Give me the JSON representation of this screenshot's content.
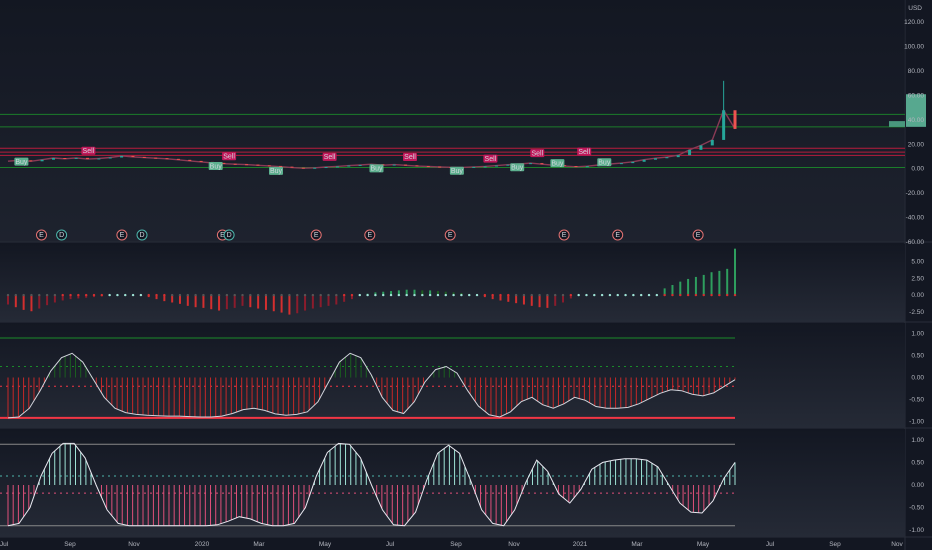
{
  "currency": "USD",
  "colors": {
    "bg": "#131722",
    "up": "#26a69a",
    "down": "#ef5350",
    "bright_red": "#f23645",
    "green_line": "#1b7d2a",
    "panel_border": "#2a2e39",
    "text": "#b2b5be",
    "tag_sell": "#c2185b",
    "tag_buy": "#5cb08e",
    "event_e": "#e57373",
    "event_d": "#4db6ac",
    "osc1_line": "#d1d4dc",
    "osc2_pos": "#9fe3d6",
    "osc2_neg": "#e0507a"
  },
  "x_axis": {
    "labels": [
      "Jul",
      "Sep",
      "Nov",
      "2020",
      "Mar",
      "May",
      "Jul",
      "Sep",
      "Nov",
      "2021",
      "Mar",
      "May",
      "Jul",
      "Sep",
      "Nov"
    ]
  },
  "chart_data": [
    {
      "type": "line",
      "panel": "price",
      "y_axis_ticks": [
        "120.00",
        "100.00",
        "80.00",
        "60.00",
        "40.00",
        "20.00",
        "0.00",
        "-20.00",
        "-40.00",
        "-60.00"
      ],
      "ylim": [
        -60,
        130
      ],
      "series": [
        {
          "values": [
            6.2,
            6.9,
            6.1,
            7.4,
            8.8,
            8.1,
            8.9,
            7.9,
            8.4,
            9.2,
            10.5,
            9.7,
            9.1,
            8.6,
            8.1,
            7.3,
            6.4,
            5.6,
            4.8,
            4.1,
            3.7,
            3.4,
            2.8,
            2.3,
            1.7,
            0.9,
            0.4,
            0.8,
            1.4,
            1.9,
            2.6,
            3.1,
            3.7,
            2.9,
            3.4,
            2.8,
            2.2,
            1.8,
            1.4,
            1.2,
            1.1,
            1.5,
            1.9,
            2.6,
            3.3,
            3.9,
            4.6,
            3.7,
            2.9,
            2.2,
            1.6,
            2.1,
            3.1,
            3.9,
            4.6,
            5.7,
            7.4,
            8.6,
            9.5,
            11.1,
            15.5,
            19.1,
            23.6,
            47.9,
            32.6
          ]
        }
      ],
      "hlines": [
        {
          "value": 44.5,
          "color": "green"
        },
        {
          "value": 34.3,
          "color": "green"
        },
        {
          "value": 16.8,
          "color": "red"
        },
        {
          "value": 13.6,
          "color": "red"
        },
        {
          "value": 10.9,
          "color": "red"
        },
        {
          "value": 1.0,
          "color": "green"
        }
      ],
      "spike_high": 72.0,
      "right_box": {
        "from": 45.0,
        "to": 34.3
      },
      "markers": [
        {
          "label": "Sell",
          "index": 12,
          "value": 14.7,
          "kind": "sell"
        },
        {
          "label": "Buy",
          "index": 2,
          "value": 5.8,
          "kind": "buy"
        },
        {
          "label": "Sell",
          "index": 33,
          "value": 10.2,
          "kind": "sell"
        },
        {
          "label": "Buy",
          "index": 31,
          "value": 2.2,
          "kind": "buy"
        },
        {
          "label": "Sell",
          "index": 48,
          "value": 9.7,
          "kind": "sell"
        },
        {
          "label": "Buy",
          "index": 40,
          "value": -1.8,
          "kind": "buy"
        },
        {
          "label": "Sell",
          "index": 60,
          "value": 9.6,
          "kind": "sell"
        },
        {
          "label": "Buy",
          "index": 55,
          "value": 0.3,
          "kind": "buy"
        },
        {
          "label": "Sell",
          "index": 72,
          "value": 8.3,
          "kind": "sell"
        },
        {
          "label": "Buy",
          "index": 67,
          "value": -1.6,
          "kind": "buy"
        },
        {
          "label": "Sell",
          "index": 79,
          "value": 12.8,
          "kind": "sell"
        },
        {
          "label": "Buy",
          "index": 76,
          "value": 1.2,
          "kind": "buy"
        },
        {
          "label": "Sell",
          "index": 86,
          "value": 14.0,
          "kind": "sell"
        },
        {
          "label": "Buy",
          "index": 82,
          "value": 4.6,
          "kind": "buy"
        },
        {
          "label": "Buy",
          "index": 89,
          "value": 5.3,
          "kind": "buy"
        }
      ],
      "events": [
        {
          "label": "E",
          "index": 5,
          "kind": "earnings"
        },
        {
          "label": "D",
          "index": 8,
          "kind": "dividend"
        },
        {
          "label": "E",
          "index": 17,
          "kind": "earnings"
        },
        {
          "label": "D",
          "index": 20,
          "kind": "dividend"
        },
        {
          "label": "E",
          "index": 32,
          "kind": "earnings"
        },
        {
          "label": "D",
          "index": 33,
          "kind": "dividend"
        },
        {
          "label": "E",
          "index": 46,
          "kind": "earnings"
        },
        {
          "label": "E",
          "index": 54,
          "kind": "earnings"
        },
        {
          "label": "E",
          "index": 66,
          "kind": "earnings"
        },
        {
          "label": "E",
          "index": 83,
          "kind": "earnings"
        },
        {
          "label": "E",
          "index": 91,
          "kind": "earnings"
        },
        {
          "label": "E",
          "index": 103,
          "kind": "earnings"
        }
      ]
    },
    {
      "type": "bar",
      "panel": "squeeze_momentum",
      "y_axis_ticks": [
        "5.00",
        "2.50",
        "0.00",
        "-2.50"
      ],
      "ylim": [
        -4,
        7
      ],
      "values": [
        -1.4,
        -1.8,
        -2.2,
        -2.4,
        -2.0,
        -1.5,
        -1.1,
        -0.8,
        -0.6,
        -0.5,
        -0.4,
        -0.3,
        -0.2,
        0,
        0,
        0,
        0,
        0,
        -0.3,
        -0.6,
        -0.9,
        -1.1,
        -1.3,
        -1.6,
        -1.8,
        -1.9,
        -2.1,
        -2.3,
        -2.1,
        -1.9,
        -1.6,
        -1.8,
        -2.0,
        -2.2,
        -2.4,
        -2.6,
        -2.9,
        -2.7,
        -2.3,
        -2.0,
        -1.8,
        -1.6,
        -1.4,
        -1.0,
        -0.6,
        0,
        0.2,
        0.4,
        0.5,
        0.6,
        0.7,
        0.8,
        0.8,
        0.7,
        0.7,
        0.6,
        0.5,
        0.4,
        0.3,
        0.1,
        0,
        -0.3,
        -0.6,
        -0.8,
        -1.0,
        -1.2,
        -1.4,
        -1.6,
        -1.8,
        -1.9,
        -1.6,
        -1.1,
        -0.5,
        0,
        0,
        0,
        0,
        0,
        0,
        0,
        0,
        0,
        0,
        0,
        1.0,
        1.5,
        2.0,
        2.4,
        2.7,
        3.0,
        3.4,
        3.6,
        3.9,
        6.9
      ]
    },
    {
      "type": "area",
      "panel": "oscillator_1",
      "y_axis_ticks": [
        "1.00",
        "0.50",
        "0.00",
        "-0.50",
        "-1.00"
      ],
      "ylim": [
        -1.15,
        1.15
      ],
      "levels": [
        0.9,
        0.25,
        -0.2,
        -0.92
      ],
      "values": [
        -0.92,
        -0.9,
        -0.7,
        -0.3,
        0.15,
        0.45,
        0.55,
        0.35,
        -0.05,
        -0.45,
        -0.7,
        -0.8,
        -0.84,
        -0.86,
        -0.87,
        -0.88,
        -0.88,
        -0.89,
        -0.9,
        -0.9,
        -0.88,
        -0.82,
        -0.73,
        -0.7,
        -0.75,
        -0.83,
        -0.86,
        -0.84,
        -0.78,
        -0.55,
        -0.1,
        0.35,
        0.55,
        0.45,
        0.05,
        -0.45,
        -0.75,
        -0.82,
        -0.55,
        -0.1,
        0.18,
        0.25,
        0.1,
        -0.3,
        -0.65,
        -0.85,
        -0.9,
        -0.78,
        -0.55,
        -0.45,
        -0.62,
        -0.7,
        -0.6,
        -0.45,
        -0.52,
        -0.66,
        -0.7,
        -0.7,
        -0.68,
        -0.6,
        -0.48,
        -0.36,
        -0.28,
        -0.3,
        -0.38,
        -0.42,
        -0.35,
        -0.2,
        -0.05
      ]
    },
    {
      "type": "area",
      "panel": "oscillator_2",
      "y_axis_ticks": [
        "1.00",
        "0.50",
        "0.00",
        "-0.50",
        "-1.00"
      ],
      "ylim": [
        -1.15,
        1.15
      ],
      "levels": [
        0.9,
        0.2,
        -0.18,
        -0.9
      ],
      "values": [
        -0.9,
        -0.85,
        -0.5,
        0.2,
        0.7,
        0.92,
        0.92,
        0.6,
        0.0,
        -0.55,
        -0.85,
        -0.9,
        -0.9,
        -0.9,
        -0.9,
        -0.9,
        -0.9,
        -0.9,
        -0.9,
        -0.88,
        -0.8,
        -0.7,
        -0.75,
        -0.85,
        -0.9,
        -0.9,
        -0.85,
        -0.5,
        0.2,
        0.72,
        0.92,
        0.9,
        0.6,
        0.0,
        -0.55,
        -0.88,
        -0.9,
        -0.6,
        0.1,
        0.7,
        0.88,
        0.7,
        0.1,
        -0.55,
        -0.85,
        -0.9,
        -0.55,
        0.05,
        0.55,
        0.3,
        -0.2,
        -0.4,
        -0.1,
        0.35,
        0.5,
        0.55,
        0.58,
        0.58,
        0.55,
        0.4,
        0.0,
        -0.4,
        -0.6,
        -0.62,
        -0.35,
        0.15,
        0.5
      ]
    }
  ]
}
